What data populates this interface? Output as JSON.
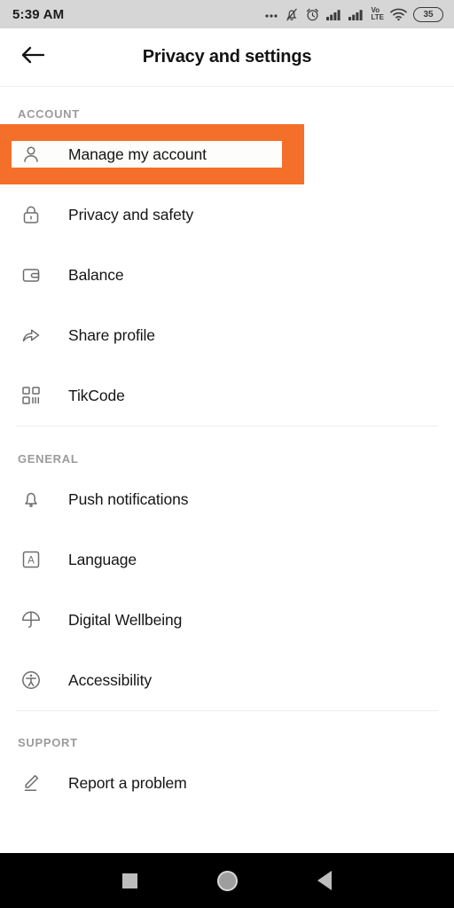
{
  "status_bar": {
    "time": "5:39 AM",
    "battery_level": "35",
    "icons": [
      "more-dots-icon",
      "notification-muted-icon",
      "alarm-clock-icon",
      "signal-bars-icon",
      "signal-bars-icon",
      "volte-icon",
      "wifi-icon",
      "battery-icon"
    ],
    "volte_top": "Vo",
    "volte_bottom": "LTE",
    "background": "#d6d6d6"
  },
  "header": {
    "title": "Privacy and settings",
    "back_icon": "arrow-left-icon"
  },
  "highlight": {
    "color": "#f4702a",
    "target_label": "Manage my account"
  },
  "sections": [
    {
      "label": "ACCOUNT",
      "items": [
        {
          "label": "Manage my account",
          "icon": "person-icon",
          "highlighted": true
        },
        {
          "label": "Privacy and safety",
          "icon": "lock-icon",
          "highlighted": false
        },
        {
          "label": "Balance",
          "icon": "wallet-icon",
          "highlighted": false
        },
        {
          "label": "Share profile",
          "icon": "share-arrow-icon",
          "highlighted": false
        },
        {
          "label": "TikCode",
          "icon": "qr-code-icon",
          "highlighted": false
        }
      ]
    },
    {
      "label": "GENERAL",
      "items": [
        {
          "label": "Push notifications",
          "icon": "bell-icon",
          "highlighted": false
        },
        {
          "label": "Language",
          "icon": "language-a-icon",
          "highlighted": false
        },
        {
          "label": "Digital Wellbeing",
          "icon": "umbrella-icon",
          "highlighted": false
        },
        {
          "label": "Accessibility",
          "icon": "accessibility-icon",
          "highlighted": false
        }
      ]
    },
    {
      "label": "SUPPORT",
      "items": [
        {
          "label": "Report a problem",
          "icon": "pencil-icon",
          "highlighted": false
        }
      ]
    }
  ],
  "nav_bar": {
    "recents_icon": "square-icon",
    "home_icon": "circle-icon",
    "back_icon": "triangle-back-icon",
    "background": "#000000"
  }
}
